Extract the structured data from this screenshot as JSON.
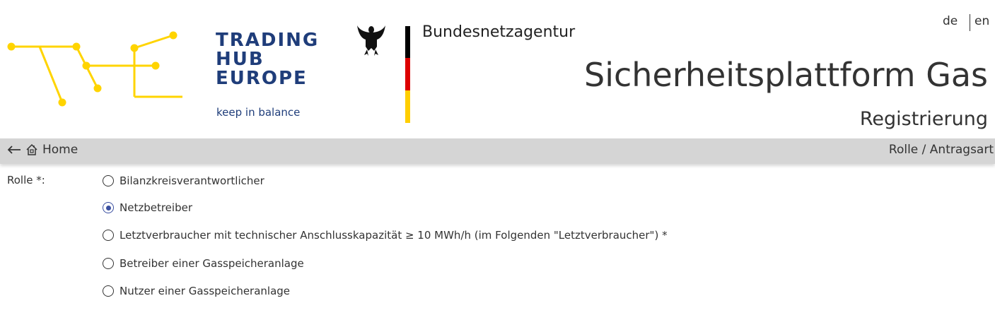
{
  "header": {
    "the_logo": {
      "line1": "TRADING",
      "line2": "HUB",
      "line3": "EUROPE",
      "tagline": "keep in balance",
      "accent_color": "#ffd400",
      "text_color": "#1f3d7a"
    },
    "bna_logo": {
      "name": "Bundesnetzagentur",
      "emblem_icon": "federal-eagle-icon"
    },
    "language": {
      "de": "de",
      "en": "en"
    },
    "title": "Sicherheitsplattform Gas",
    "subtitle": "Registrierung"
  },
  "navbar": {
    "back_icon": "arrow-left-icon",
    "home_icon": "home-icon",
    "home_label": "Home",
    "step_label": "Rolle / Antragsart",
    "background": "#d5d5d5"
  },
  "form": {
    "role_label": "Rolle *:",
    "options": [
      {
        "label": "Bilanzkreisverantwortlicher",
        "checked": false
      },
      {
        "label": "Netzbetreiber",
        "checked": true
      },
      {
        "label": "Letztverbraucher mit technischer Anschlusskapazität ≥ 10 MWh/h (im Folgenden \"Letztverbraucher\") *",
        "checked": false
      },
      {
        "label": "Betreiber einer Gasspeicheranlage",
        "checked": false
      },
      {
        "label": "Nutzer einer Gasspeicheranlage",
        "checked": false
      }
    ]
  }
}
